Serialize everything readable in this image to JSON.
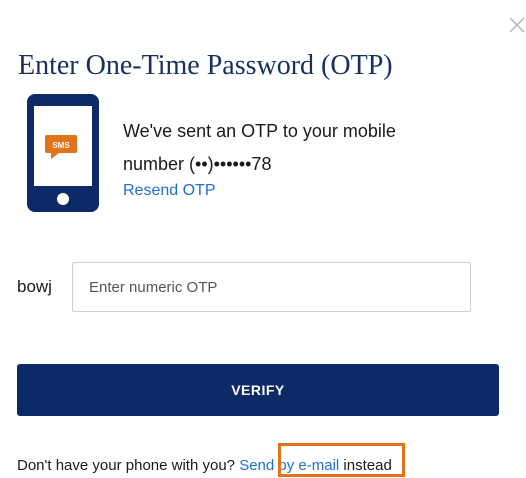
{
  "dialog": {
    "title": "Enter One-Time Password (OTP)",
    "close_icon": "close-icon"
  },
  "illustration": {
    "icon": "phone-sms-icon",
    "badge_text": "SMS",
    "phone_color": "#0c2a66",
    "badge_color": "#e0731b"
  },
  "message": {
    "line1": "We've sent an OTP to your mobile",
    "line2": "number (••)••••••78",
    "resend_label": "Resend OTP"
  },
  "otp_field": {
    "label": "bowj",
    "placeholder": "Enter numeric OTP",
    "value": ""
  },
  "verify_button": {
    "label": "VERIFY",
    "color": "#0c2a66"
  },
  "footer": {
    "prefix": "Don't have your phone with you? ",
    "link_label": "Send by e-mail",
    "suffix": " instead",
    "link_color": "#1f6ed4",
    "highlight_color": "#e0731b"
  }
}
